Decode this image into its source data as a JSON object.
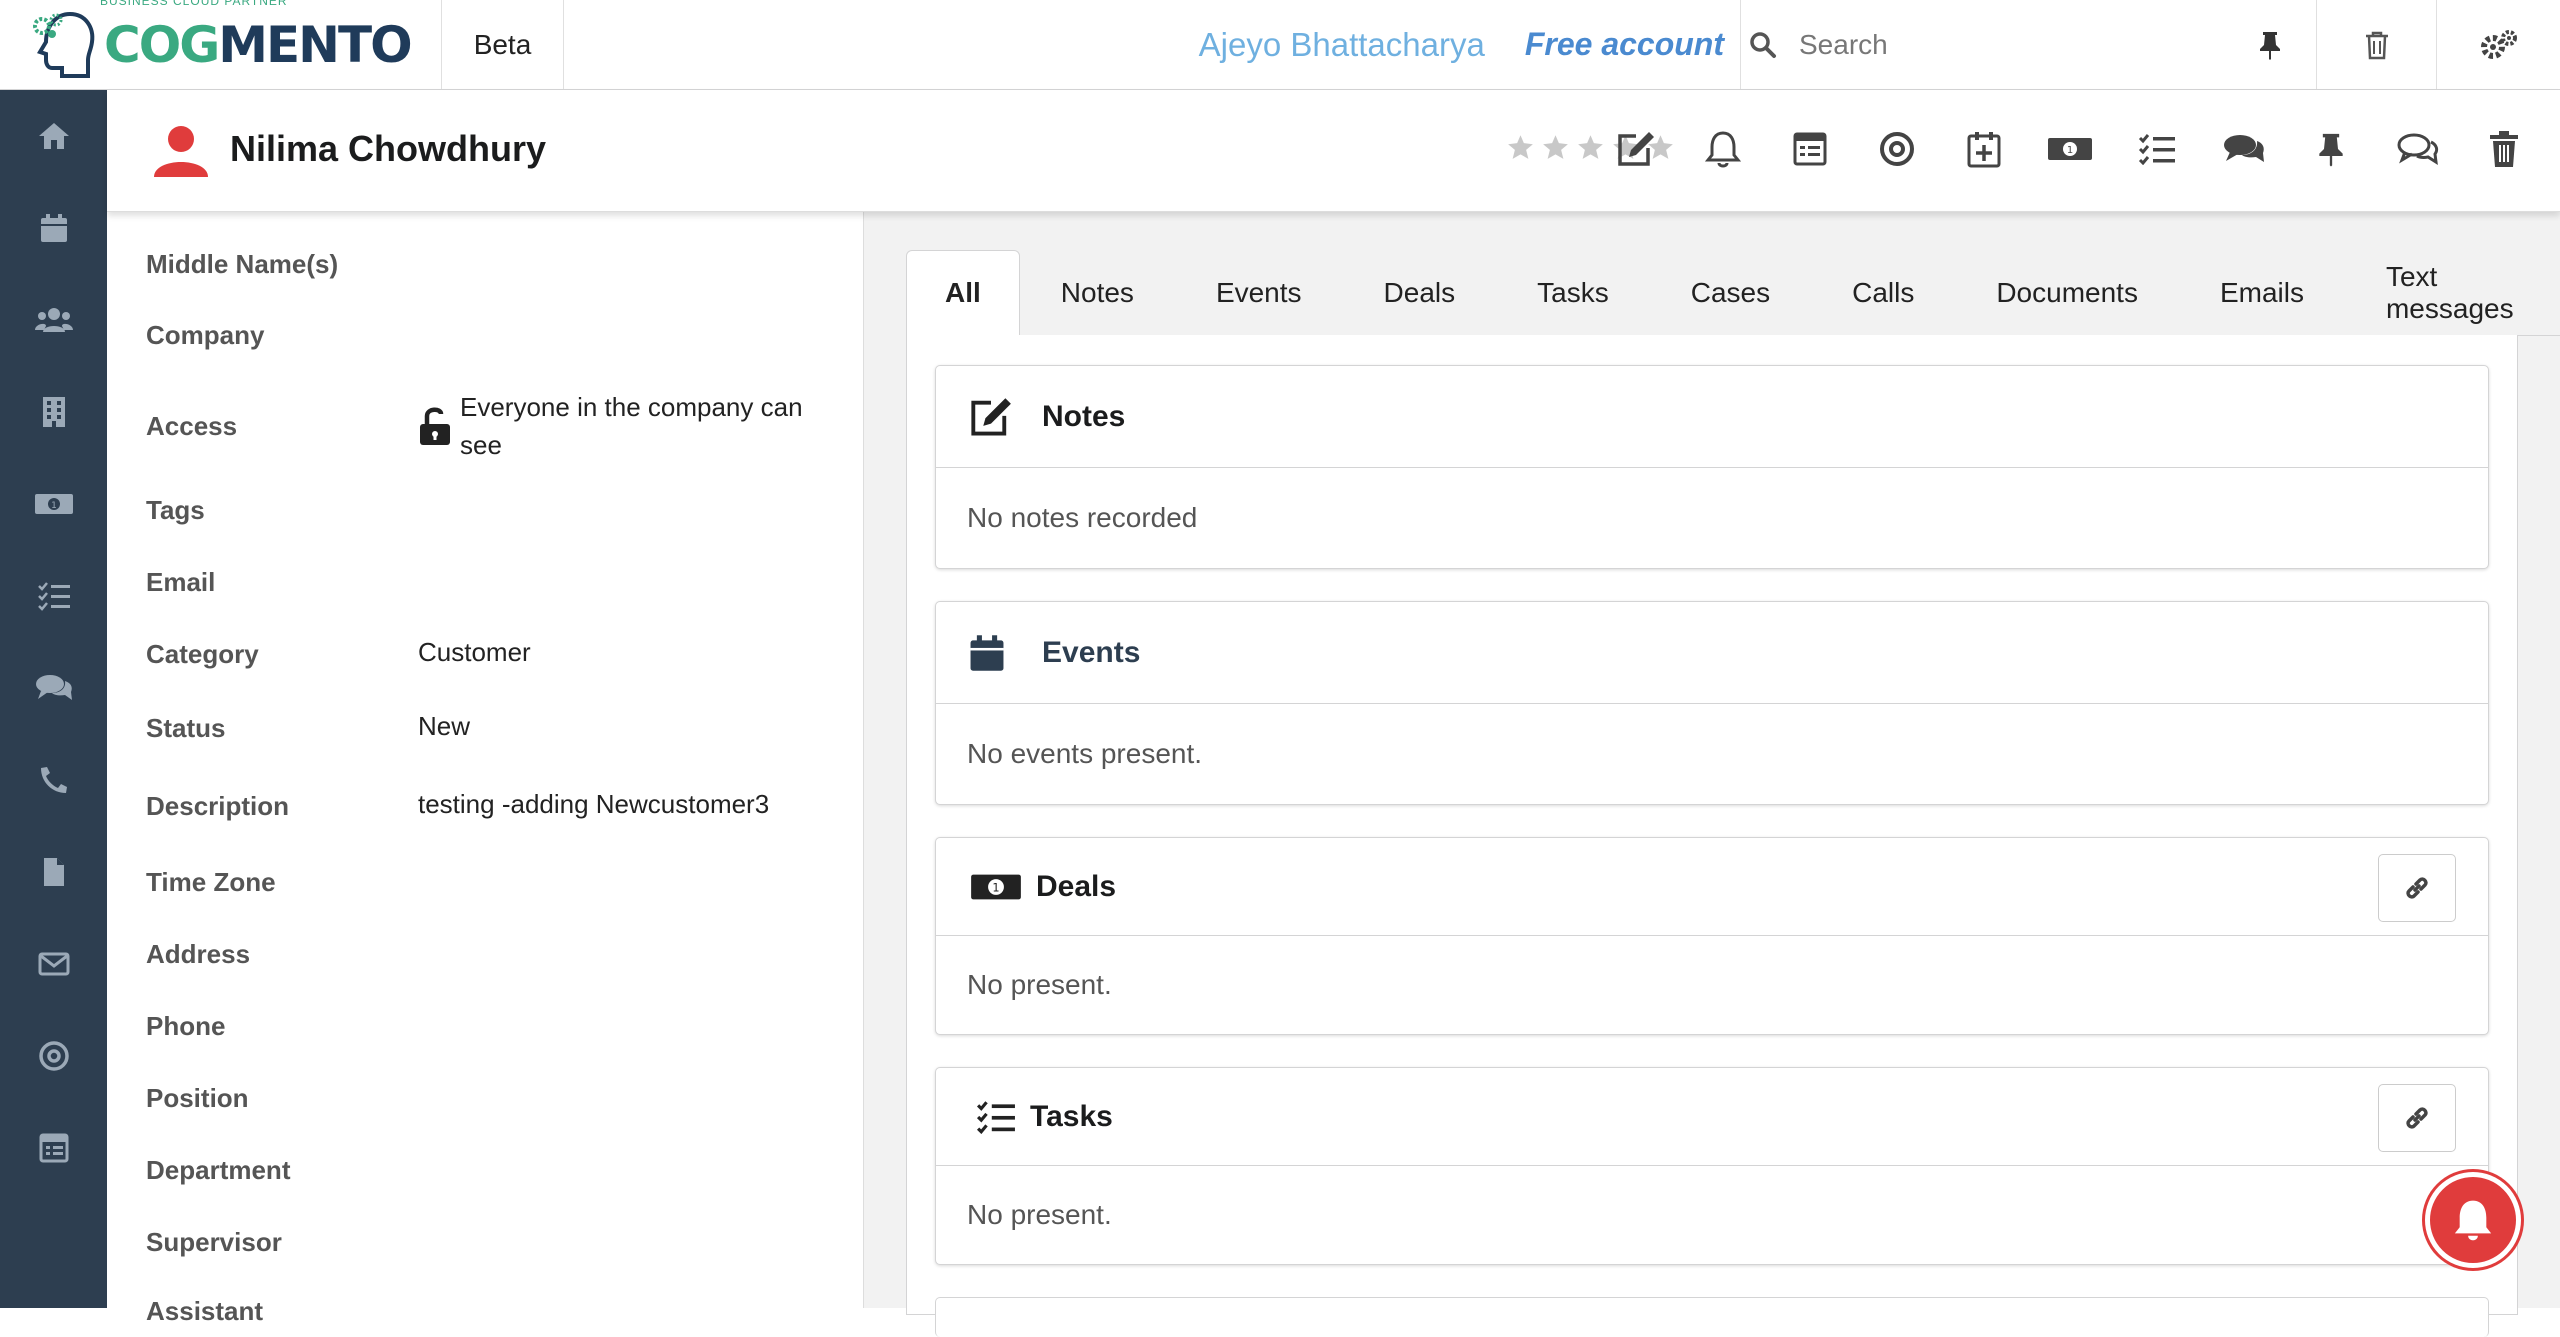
{
  "topbar": {
    "logo_tagline": "BUSINESS CLOUD PARTNER",
    "logo_part1": "COG",
    "logo_part2": "MENTO",
    "beta_label": "Beta",
    "user_name": "Ajeyo Bhattacharya",
    "account_type": "Free account",
    "search_placeholder": "Search"
  },
  "sidebar": {
    "items": [
      {
        "icon": "home-icon"
      },
      {
        "icon": "calendar-icon"
      },
      {
        "icon": "contacts-icon"
      },
      {
        "icon": "building-icon"
      },
      {
        "icon": "money-icon"
      },
      {
        "icon": "tasks-icon"
      },
      {
        "icon": "comments-icon"
      },
      {
        "icon": "phone-icon"
      },
      {
        "icon": "document-icon"
      },
      {
        "icon": "email-icon"
      },
      {
        "icon": "target-icon"
      },
      {
        "icon": "calculator-icon"
      }
    ]
  },
  "contact": {
    "name": "Nilima Chowdhury",
    "rating": 0,
    "rating_max": 5
  },
  "header_actions": [
    "edit-icon",
    "bell-icon",
    "calculator-icon",
    "target-icon",
    "calendar-add-icon",
    "money-icon",
    "tasks-icon",
    "comments-icon",
    "pin-icon",
    "chat-icon",
    "trash-icon"
  ],
  "details": {
    "middle_name": {
      "label": "Middle Name(s)",
      "value": ""
    },
    "company": {
      "label": "Company",
      "value": ""
    },
    "access": {
      "label": "Access",
      "value_line1": "Everyone in the company can",
      "value_line2": "see"
    },
    "tags": {
      "label": "Tags",
      "value": ""
    },
    "email": {
      "label": "Email",
      "value": ""
    },
    "category": {
      "label": "Category",
      "value": "Customer"
    },
    "status": {
      "label": "Status",
      "value": "New"
    },
    "description": {
      "label": "Description",
      "value": "testing -adding Newcustomer3"
    },
    "time_zone": {
      "label": "Time Zone",
      "value": ""
    },
    "address": {
      "label": "Address",
      "value": ""
    },
    "phone": {
      "label": "Phone",
      "value": ""
    },
    "position": {
      "label": "Position",
      "value": ""
    },
    "department": {
      "label": "Department",
      "value": ""
    },
    "supervisor": {
      "label": "Supervisor",
      "value": ""
    },
    "assistant": {
      "label": "Assistant",
      "value": ""
    }
  },
  "tabs": [
    "All",
    "Notes",
    "Events",
    "Deals",
    "Tasks",
    "Cases",
    "Calls",
    "Documents",
    "Emails",
    "Text messages"
  ],
  "active_tab": "All",
  "cards": {
    "notes": {
      "title": "Notes",
      "empty": "No notes recorded"
    },
    "events": {
      "title": "Events",
      "empty": "No events present."
    },
    "deals": {
      "title": "Deals",
      "empty": "No present."
    },
    "tasks": {
      "title": "Tasks",
      "empty": "No present."
    }
  },
  "colors": {
    "sidebar_bg": "#2d3e50",
    "brand_green": "#3aa981",
    "brand_navy": "#1f3b5a",
    "user_name": "#6fb0e0",
    "account": "#4a8ad0",
    "person_icon": "#e03c3c",
    "notification_fab": "#e03c3c"
  }
}
